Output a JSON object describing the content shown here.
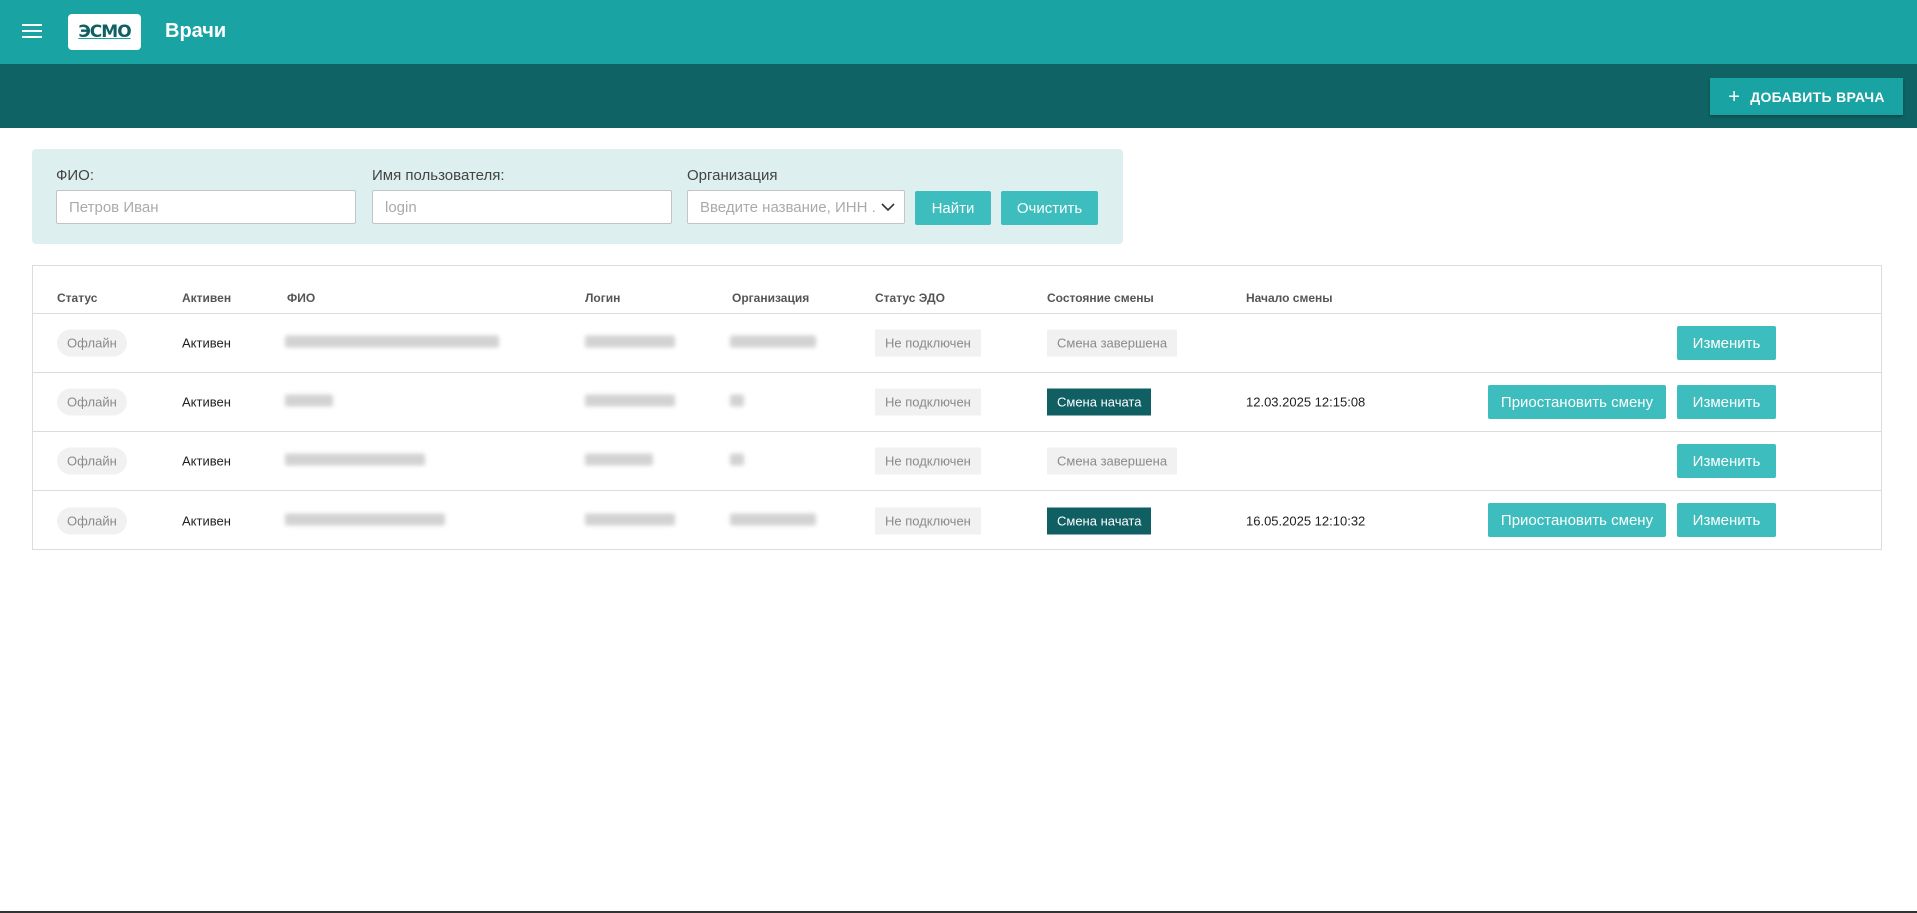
{
  "header": {
    "logo_text": "ЭСМО",
    "title": "Врачи",
    "menu_icon": "hamburger-icon",
    "add_button_label": "ДОБАВИТЬ ВРАЧА",
    "add_button_icon": "plus-icon"
  },
  "filter": {
    "fio_label": "ФИО:",
    "fio_placeholder": "Петров Иван",
    "username_label": "Имя пользователя:",
    "username_placeholder": "login",
    "org_label": "Организация",
    "org_placeholder": "Введите название, ИНН ...",
    "find_label": "Найти",
    "clear_label": "Очистить"
  },
  "table": {
    "columns": [
      "Статус",
      "Активен",
      "ФИО",
      "Логин",
      "Организация",
      "Статус ЭДО",
      "Состояние смены",
      "Начало смены"
    ],
    "rows": [
      {
        "status": "Офлайн",
        "active": "Активен",
        "edo": "Не подключен",
        "shift_state": "Смена завершена",
        "shift_started": false,
        "shift_start": "",
        "edit_label": "Изменить",
        "pause_label": ""
      },
      {
        "status": "Офлайн",
        "active": "Активен",
        "edo": "Не подключен",
        "shift_state": "Смена начата",
        "shift_started": true,
        "shift_start": "12.03.2025 12:15:08",
        "edit_label": "Изменить",
        "pause_label": "Приостановить смену"
      },
      {
        "status": "Офлайн",
        "active": "Активен",
        "edo": "Не подключен",
        "shift_state": "Смена завершена",
        "shift_started": false,
        "shift_start": "",
        "edit_label": "Изменить",
        "pause_label": ""
      },
      {
        "status": "Офлайн",
        "active": "Активен",
        "edo": "Не подключен",
        "shift_state": "Смена начата",
        "shift_started": true,
        "shift_start": "16.05.2025 12:10:32",
        "edit_label": "Изменить",
        "pause_label": "Приостановить смену"
      }
    ]
  },
  "colors": {
    "primary": "#1aa3a3",
    "dark": "#106364",
    "button": "#3dbdbd",
    "filter_bg": "#ddf0ef"
  }
}
